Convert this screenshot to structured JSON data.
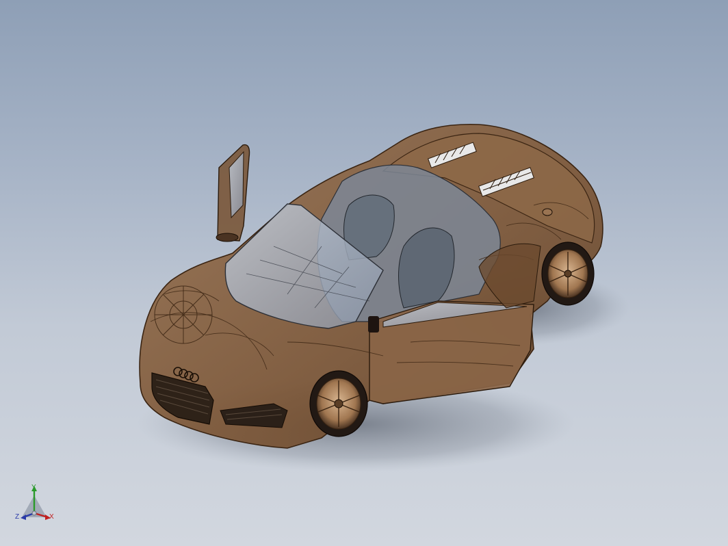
{
  "viewport": {
    "background_top": "#8e9fb6",
    "background_bottom": "#d2d7df"
  },
  "model": {
    "body_color": "#7a5738",
    "edge_color": "#3a2412",
    "glass_color": "#9aa6b8",
    "logo_icon": "four-rings-logo"
  },
  "triad": {
    "x_label": "X",
    "y_label": "Y",
    "z_label": "Z",
    "x_color": "#c02020",
    "y_color": "#2a9a2a",
    "z_color": "#2a3aa8"
  }
}
